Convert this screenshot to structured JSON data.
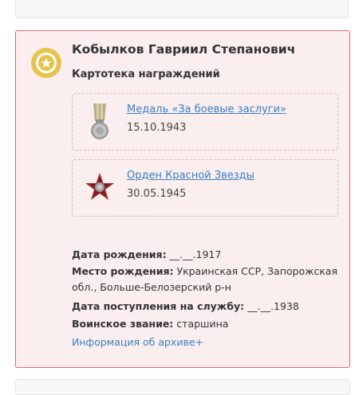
{
  "person": {
    "name": "Кобылков Гавриил Степанович",
    "subtitle": "Картотека награждений"
  },
  "awards": [
    {
      "title": "Медаль «За боевые заслуги»",
      "date": "15.10.1943",
      "icon": "medal-icon"
    },
    {
      "title": "Орден Красной Звезды",
      "date": "30.05.1945",
      "icon": "red-star-order-icon"
    }
  ],
  "details": {
    "birth_date_label": "Дата рождения:",
    "birth_date_value": " __.__.1917",
    "birth_place_label": "Место рождения:",
    "birth_place_value": " Украинская ССР, Запорожская обл., Больше-Белозерский р-н",
    "service_start_label": "Дата поступления на службу:",
    "service_start_value": " __.__.1938",
    "rank_label": "Воинское звание:",
    "rank_value": " старшина"
  },
  "archive_link": "Информация об архиве+",
  "colors": {
    "card_border": "#e06a6a",
    "card_bg": "#fbeeee",
    "link": "#3a7fc4",
    "badge_gold": "#e6c34a"
  }
}
